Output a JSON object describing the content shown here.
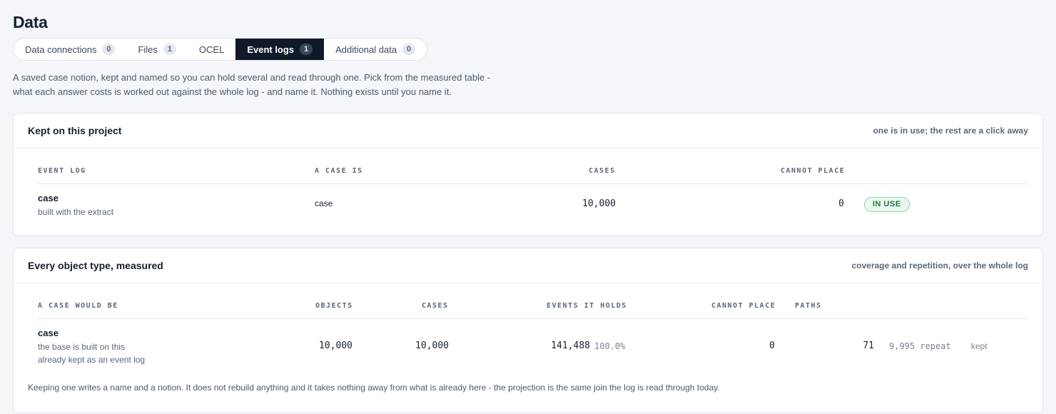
{
  "page": {
    "title": "Data"
  },
  "tabs": [
    {
      "label": "Data connections",
      "count": "0",
      "active": false
    },
    {
      "label": "Files",
      "count": "1",
      "active": false
    },
    {
      "label": "OCEL",
      "count": "",
      "active": false
    },
    {
      "label": "Event logs",
      "count": "1",
      "active": true
    },
    {
      "label": "Additional data",
      "count": "0",
      "active": false
    }
  ],
  "intro": {
    "line1": "A saved case notion, kept and named so you can hold several and read through one. Pick from the measured table -",
    "line2": "what each answer costs is worked out against the whole log - and name it. Nothing exists until you name it."
  },
  "kept": {
    "title": "Kept on this project",
    "note": "one is in use; the rest are a click away",
    "headers": {
      "log": "EVENT LOG",
      "case_is": "A CASE IS",
      "cases": "CASES",
      "cannot": "CANNOT PLACE"
    },
    "row": {
      "name": "case",
      "desc": "built with the extract",
      "case_is": "case",
      "cases": "10,000",
      "cannot": "0",
      "status": "IN USE"
    }
  },
  "measured": {
    "title": "Every object type, measured",
    "note": "coverage and repetition, over the whole log",
    "headers": {
      "would_be": "A CASE WOULD BE",
      "objects": "OBJECTS",
      "cases": "CASES",
      "events": "EVENTS IT HOLDS",
      "cannot": "CANNOT PLACE",
      "paths": "PATHS"
    },
    "row": {
      "name": "case",
      "desc1": "the base is built on this",
      "desc2": "already kept as an event log",
      "objects": "10,000",
      "cases": "10,000",
      "events": "141,488",
      "events_pct": "100.0%",
      "cannot": "0",
      "paths": "71",
      "repeat": "9,995 repeat",
      "action": "kept"
    },
    "footnote": "Keeping one writes a name and a notion. It does not rebuild anything and it takes nothing away from what is already here - the projection is the same join the log is read through today."
  }
}
